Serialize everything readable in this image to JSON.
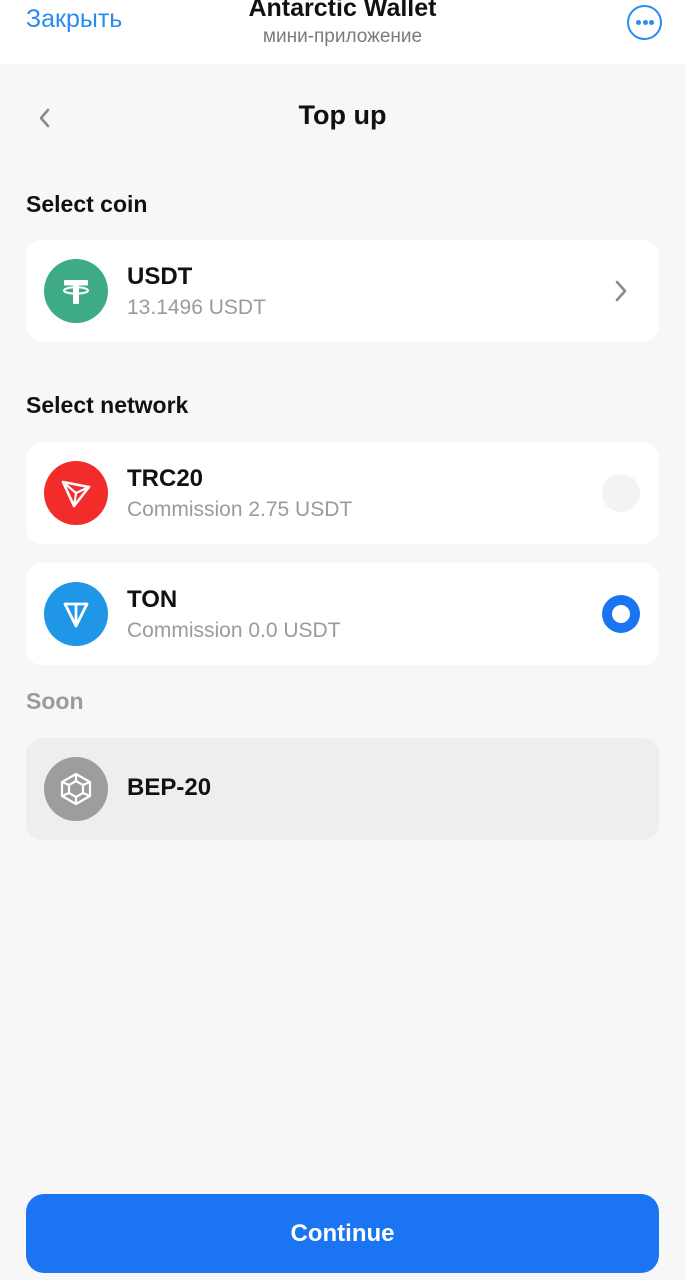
{
  "header": {
    "close_label": "Закрыть",
    "app_title": "Antarctic Wallet",
    "app_subtitle": "мини-приложение",
    "more_icon": "more-horizontal-icon"
  },
  "nav": {
    "back_icon": "chevron-left-icon",
    "title": "Top up"
  },
  "coin_section": {
    "label": "Select coin",
    "coin": {
      "icon": "tether-icon",
      "name": "USDT",
      "balance": "13.1496 USDT",
      "color": "#3eab85"
    }
  },
  "network_section": {
    "label": "Select network",
    "networks": [
      {
        "icon": "tron-icon",
        "name": "TRC20",
        "commission": "Commission 2.75 USDT",
        "selected": false,
        "color": "#f22b2b"
      },
      {
        "icon": "ton-icon",
        "name": "TON",
        "commission": "Commission 0.0 USDT",
        "selected": true,
        "color": "#1f97e6"
      }
    ]
  },
  "soon_section": {
    "label": "Soon",
    "networks": [
      {
        "icon": "binance-icon",
        "name": "BEP-20",
        "color": "#9d9d9d"
      }
    ]
  },
  "footer": {
    "continue_label": "Continue"
  },
  "colors": {
    "accent": "#1b74f2",
    "link": "#2a8bf2",
    "background": "#f7f7f7"
  }
}
